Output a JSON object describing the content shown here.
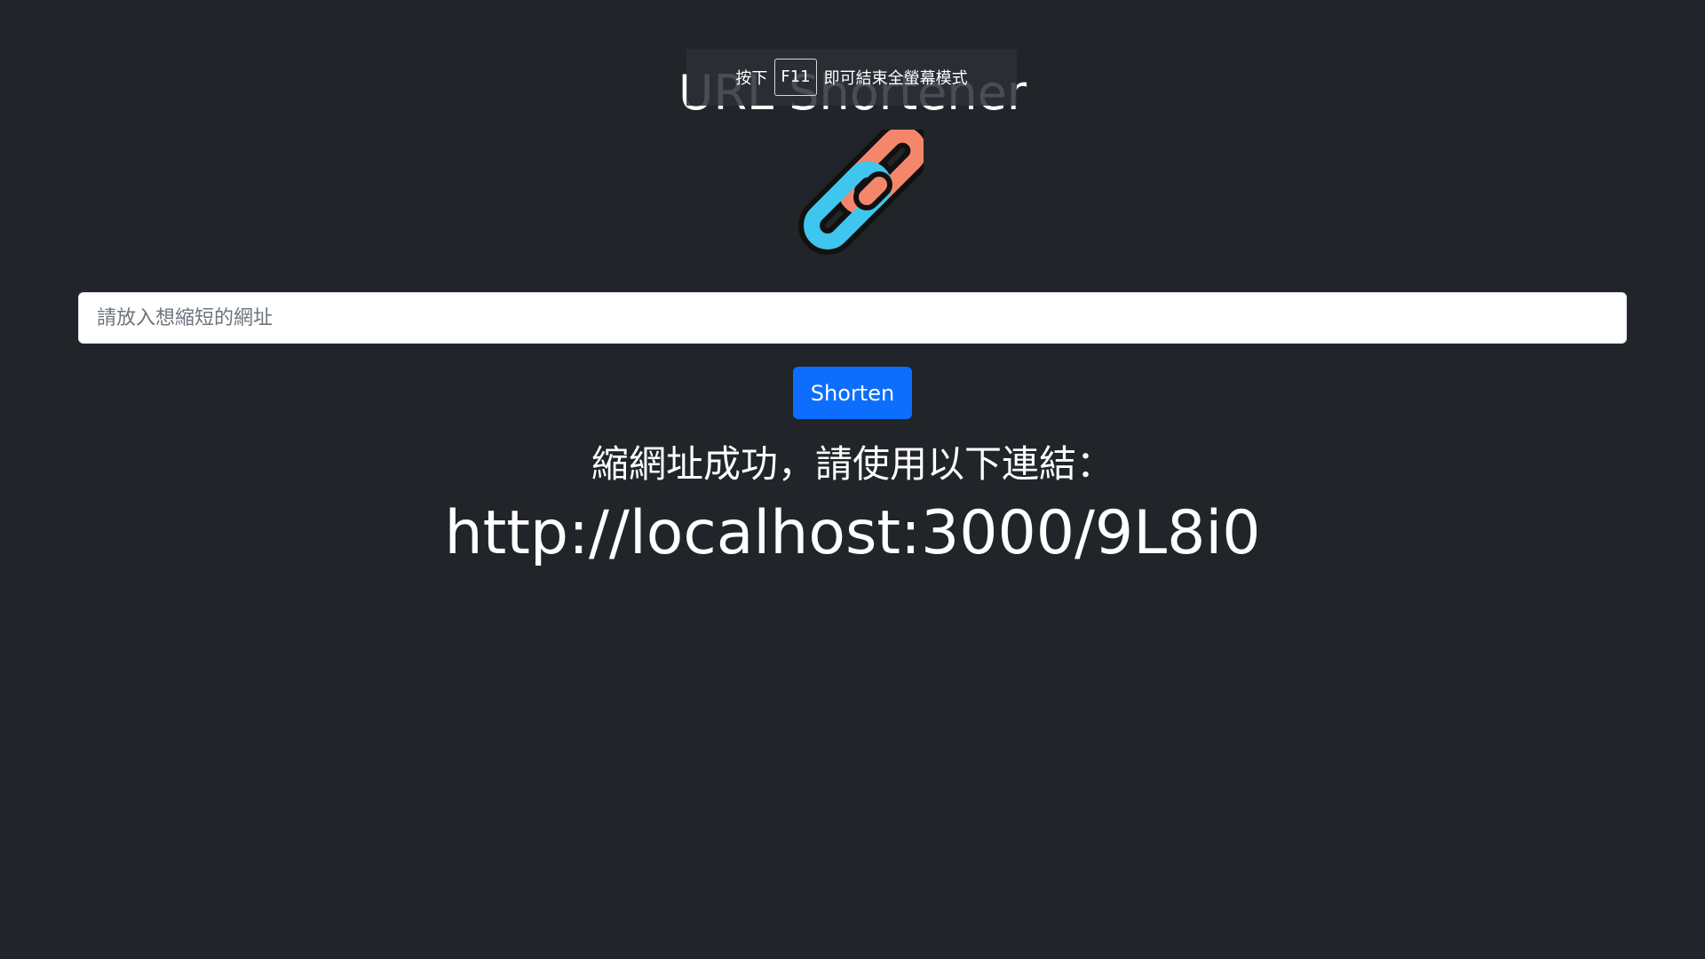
{
  "app": {
    "title": "URL Shortener",
    "logo_icon": "link-chain-icon",
    "colors": {
      "background": "#212529",
      "button": "#0d6efd",
      "link_orange": "#f4876b",
      "link_blue": "#3ec6ee"
    }
  },
  "fullscreen_notice": {
    "prefix": "按下",
    "key": "F11",
    "suffix": "即可結束全螢幕模式"
  },
  "form": {
    "input_value": "",
    "input_placeholder": "請放入想縮短的網址",
    "submit_label": "Shorten"
  },
  "result": {
    "message": "縮網址成功，請使用以下連結：",
    "short_url": "http://localhost:3000/9L8i0"
  }
}
